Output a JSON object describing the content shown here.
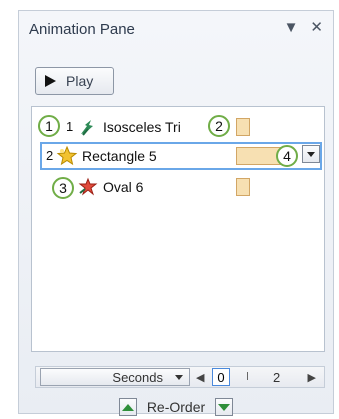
{
  "pane": {
    "title": "Animation Pane",
    "dropdown_symbol": "▼",
    "close_symbol": "✕"
  },
  "toolbar": {
    "play_label": "Play"
  },
  "animations": [
    {
      "order": "1",
      "label": "Isosceles Tri",
      "icon": "entrance-effect-icon"
    },
    {
      "order": "2",
      "label": "Rectangle 5",
      "icon": "emphasis-effect-icon"
    },
    {
      "order": "",
      "label": "Oval 6",
      "icon": "exit-effect-icon"
    }
  ],
  "callouts": [
    "1",
    "2",
    "3",
    "4"
  ],
  "timeline": {
    "unit_label": "Seconds",
    "current": "0",
    "next_tick": "2"
  },
  "reorder": {
    "label": "Re-Order"
  },
  "colors": {
    "callout_border": "#70ad47",
    "selection_border": "#6aa7e8",
    "timing_bar_fill": "#f7e0b2"
  }
}
